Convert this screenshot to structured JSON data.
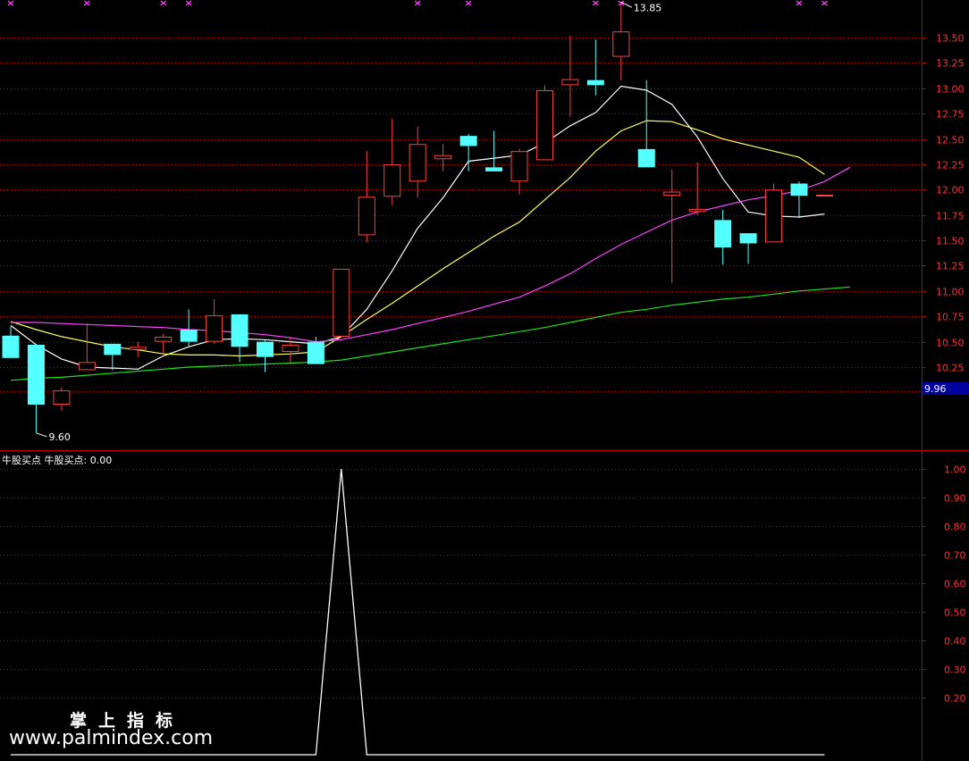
{
  "colors": {
    "background": "#000000",
    "axis": "#c00000",
    "grid": "#c00000",
    "up_candle": "#ff4040",
    "down_candle": "#54ffff",
    "ma5": "#ffffff",
    "ma10": "#ffff60",
    "ma20": "#ff40ff",
    "ma60": "#20e020",
    "indicator": "#ffffff",
    "label_text": "#ff3030",
    "price_tag_bg": "#0000a0"
  },
  "chart_data": [
    {
      "type": "candlestick",
      "y_ticks": [
        "13.50",
        "13.25",
        "13.00",
        "12.75",
        "12.50",
        "12.25",
        "12.00",
        "11.75",
        "11.50",
        "11.25",
        "11.00",
        "10.75",
        "10.50",
        "10.25"
      ],
      "ylim": [
        9.4,
        13.95
      ],
      "grid": true,
      "last_price_label": "9.96",
      "max_label": "13.85",
      "min_label": "9.60",
      "candles": [
        {
          "o": 10.56,
          "h": 10.65,
          "l": 10.56,
          "c": 10.34
        },
        {
          "o": 10.47,
          "h": 10.47,
          "l": 9.6,
          "c": 9.88
        },
        {
          "o": 9.88,
          "h": 10.05,
          "l": 9.82,
          "c": 10.02
        },
        {
          "o": 10.22,
          "h": 10.68,
          "l": 10.22,
          "c": 10.3
        },
        {
          "o": 10.48,
          "h": 10.48,
          "l": 10.22,
          "c": 10.37
        },
        {
          "o": 10.42,
          "h": 10.5,
          "l": 10.35,
          "c": 10.45
        },
        {
          "o": 10.5,
          "h": 10.58,
          "l": 10.38,
          "c": 10.55
        },
        {
          "o": 10.62,
          "h": 10.82,
          "l": 10.45,
          "c": 10.5
        },
        {
          "o": 10.5,
          "h": 10.92,
          "l": 10.48,
          "c": 10.76
        },
        {
          "o": 10.77,
          "h": 10.77,
          "l": 10.3,
          "c": 10.45
        },
        {
          "o": 10.5,
          "h": 10.52,
          "l": 10.2,
          "c": 10.35
        },
        {
          "o": 10.4,
          "h": 10.54,
          "l": 10.28,
          "c": 10.47
        },
        {
          "o": 10.5,
          "h": 10.55,
          "l": 10.28,
          "c": 10.28
        },
        {
          "o": 10.55,
          "h": 11.22,
          "l": 10.55,
          "c": 11.22
        },
        {
          "o": 11.55,
          "h": 12.38,
          "l": 11.48,
          "c": 11.93
        },
        {
          "o": 11.93,
          "h": 12.7,
          "l": 11.85,
          "c": 12.25
        },
        {
          "o": 12.08,
          "h": 12.62,
          "l": 11.92,
          "c": 12.45
        },
        {
          "o": 12.3,
          "h": 12.45,
          "l": 12.18,
          "c": 12.34
        },
        {
          "o": 12.53,
          "h": 12.55,
          "l": 12.18,
          "c": 12.43
        },
        {
          "o": 12.22,
          "h": 12.58,
          "l": 12.18,
          "c": 12.18
        },
        {
          "o": 12.08,
          "h": 12.4,
          "l": 11.95,
          "c": 12.38
        },
        {
          "o": 12.29,
          "h": 13.03,
          "l": 12.29,
          "c": 12.98
        },
        {
          "o": 13.03,
          "h": 13.52,
          "l": 12.72,
          "c": 13.09
        },
        {
          "o": 13.08,
          "h": 13.48,
          "l": 12.93,
          "c": 13.03
        },
        {
          "o": 13.31,
          "h": 13.85,
          "l": 13.08,
          "c": 13.56
        },
        {
          "o": 12.4,
          "h": 13.08,
          "l": 12.22,
          "c": 12.22
        },
        {
          "o": 11.94,
          "h": 12.2,
          "l": 11.08,
          "c": 11.98
        },
        {
          "o": 11.78,
          "h": 12.27,
          "l": 11.75,
          "c": 11.81
        },
        {
          "o": 11.7,
          "h": 11.8,
          "l": 11.26,
          "c": 11.43
        },
        {
          "o": 11.57,
          "h": 11.57,
          "l": 11.27,
          "c": 11.47
        },
        {
          "o": 11.48,
          "h": 12.06,
          "l": 11.48,
          "c": 12.0
        },
        {
          "o": 12.06,
          "h": 12.08,
          "l": 11.72,
          "c": 11.94
        },
        {
          "o": 11.95,
          "h": 11.95,
          "l": 11.95,
          "c": 11.95
        }
      ],
      "moving_averages": [
        {
          "color_key": "ma5",
          "points": [
            [
              0,
              10.66
            ],
            [
              1,
              10.47
            ],
            [
              2,
              10.33
            ],
            [
              3,
              10.25
            ],
            [
              4,
              10.24
            ],
            [
              5,
              10.23
            ],
            [
              6,
              10.36
            ],
            [
              7,
              10.45
            ],
            [
              8,
              10.52
            ],
            [
              9,
              10.53
            ],
            [
              10,
              10.52
            ],
            [
              11,
              10.5
            ],
            [
              12,
              10.48
            ],
            [
              13,
              10.55
            ],
            [
              14,
              10.82
            ],
            [
              15,
              11.2
            ],
            [
              16,
              11.62
            ],
            [
              17,
              11.92
            ],
            [
              18,
              12.28
            ],
            [
              19,
              12.31
            ],
            [
              20,
              12.34
            ],
            [
              21,
              12.46
            ],
            [
              22,
              12.63
            ],
            [
              23,
              12.76
            ],
            [
              24,
              13.02
            ],
            [
              25,
              12.98
            ],
            [
              26,
              12.84
            ],
            [
              27,
              12.52
            ],
            [
              28,
              12.11
            ],
            [
              29,
              11.78
            ],
            [
              30,
              11.74
            ],
            [
              31,
              11.73
            ],
            [
              32,
              11.76
            ]
          ]
        },
        {
          "color_key": "ma10",
          "points": [
            [
              0,
              10.7
            ],
            [
              1,
              10.62
            ],
            [
              2,
              10.55
            ],
            [
              3,
              10.5
            ],
            [
              4,
              10.45
            ],
            [
              5,
              10.42
            ],
            [
              6,
              10.38
            ],
            [
              7,
              10.37
            ],
            [
              8,
              10.37
            ],
            [
              9,
              10.36
            ],
            [
              10,
              10.37
            ],
            [
              11,
              10.38
            ],
            [
              12,
              10.4
            ],
            [
              13,
              10.55
            ],
            [
              14,
              10.72
            ],
            [
              15,
              10.88
            ],
            [
              16,
              11.05
            ],
            [
              17,
              11.22
            ],
            [
              18,
              11.38
            ],
            [
              19,
              11.54
            ],
            [
              20,
              11.68
            ],
            [
              21,
              11.9
            ],
            [
              22,
              12.12
            ],
            [
              23,
              12.38
            ],
            [
              24,
              12.58
            ],
            [
              25,
              12.68
            ],
            [
              26,
              12.67
            ],
            [
              27,
              12.59
            ],
            [
              28,
              12.5
            ],
            [
              29,
              12.44
            ],
            [
              30,
              12.38
            ],
            [
              31,
              12.32
            ],
            [
              32,
              12.15
            ]
          ]
        },
        {
          "color_key": "ma20",
          "points": [
            [
              0,
              10.69
            ],
            [
              1,
              10.69
            ],
            [
              2,
              10.68
            ],
            [
              3,
              10.67
            ],
            [
              4,
              10.66
            ],
            [
              5,
              10.65
            ],
            [
              6,
              10.64
            ],
            [
              7,
              10.62
            ],
            [
              8,
              10.61
            ],
            [
              9,
              10.59
            ],
            [
              10,
              10.57
            ],
            [
              11,
              10.54
            ],
            [
              12,
              10.5
            ],
            [
              13,
              10.52
            ],
            [
              14,
              10.57
            ],
            [
              15,
              10.62
            ],
            [
              16,
              10.68
            ],
            [
              17,
              10.74
            ],
            [
              18,
              10.8
            ],
            [
              19,
              10.87
            ],
            [
              20,
              10.94
            ],
            [
              21,
              11.05
            ],
            [
              22,
              11.17
            ],
            [
              23,
              11.32
            ],
            [
              24,
              11.46
            ],
            [
              25,
              11.58
            ],
            [
              26,
              11.7
            ],
            [
              27,
              11.78
            ],
            [
              28,
              11.84
            ],
            [
              29,
              11.9
            ],
            [
              30,
              11.94
            ],
            [
              31,
              11.99
            ],
            [
              32,
              12.08
            ],
            [
              33,
              12.22
            ]
          ]
        },
        {
          "color_key": "ma60",
          "points": [
            [
              0,
              10.12
            ],
            [
              1,
              10.14
            ],
            [
              2,
              10.15
            ],
            [
              3,
              10.17
            ],
            [
              4,
              10.19
            ],
            [
              5,
              10.21
            ],
            [
              6,
              10.23
            ],
            [
              7,
              10.25
            ],
            [
              8,
              10.26
            ],
            [
              9,
              10.27
            ],
            [
              10,
              10.28
            ],
            [
              11,
              10.29
            ],
            [
              12,
              10.3
            ],
            [
              13,
              10.32
            ],
            [
              14,
              10.36
            ],
            [
              15,
              10.4
            ],
            [
              16,
              10.44
            ],
            [
              17,
              10.48
            ],
            [
              18,
              10.52
            ],
            [
              19,
              10.56
            ],
            [
              20,
              10.6
            ],
            [
              21,
              10.64
            ],
            [
              22,
              10.69
            ],
            [
              23,
              10.74
            ],
            [
              24,
              10.79
            ],
            [
              25,
              10.82
            ],
            [
              26,
              10.86
            ],
            [
              27,
              10.89
            ],
            [
              28,
              10.92
            ],
            [
              29,
              10.94
            ],
            [
              30,
              10.97
            ],
            [
              31,
              11.0
            ],
            [
              32,
              11.02
            ],
            [
              33,
              11.04
            ]
          ]
        }
      ],
      "signal_markers_at_index": [
        0,
        3,
        6,
        7,
        16,
        18,
        23,
        24,
        31,
        32
      ]
    },
    {
      "type": "line",
      "title": "牛股买点",
      "series_label": "牛股买点: 0.00",
      "y_ticks": [
        "1.00",
        "0.90",
        "0.80",
        "0.70",
        "0.60",
        "0.50",
        "0.40",
        "0.30",
        "0.20"
      ],
      "ylim": [
        -0.02,
        1.04
      ],
      "grid": true,
      "values": [
        0,
        0,
        0,
        0,
        0,
        0,
        0,
        0,
        0,
        0,
        0,
        0,
        0,
        1,
        0,
        0,
        0,
        0,
        0,
        0,
        0,
        0,
        0,
        0,
        0,
        0,
        0,
        0,
        0,
        0,
        0,
        0,
        0
      ]
    }
  ],
  "watermark": {
    "cn": "掌上指标",
    "url": "www.palmindex.com"
  }
}
